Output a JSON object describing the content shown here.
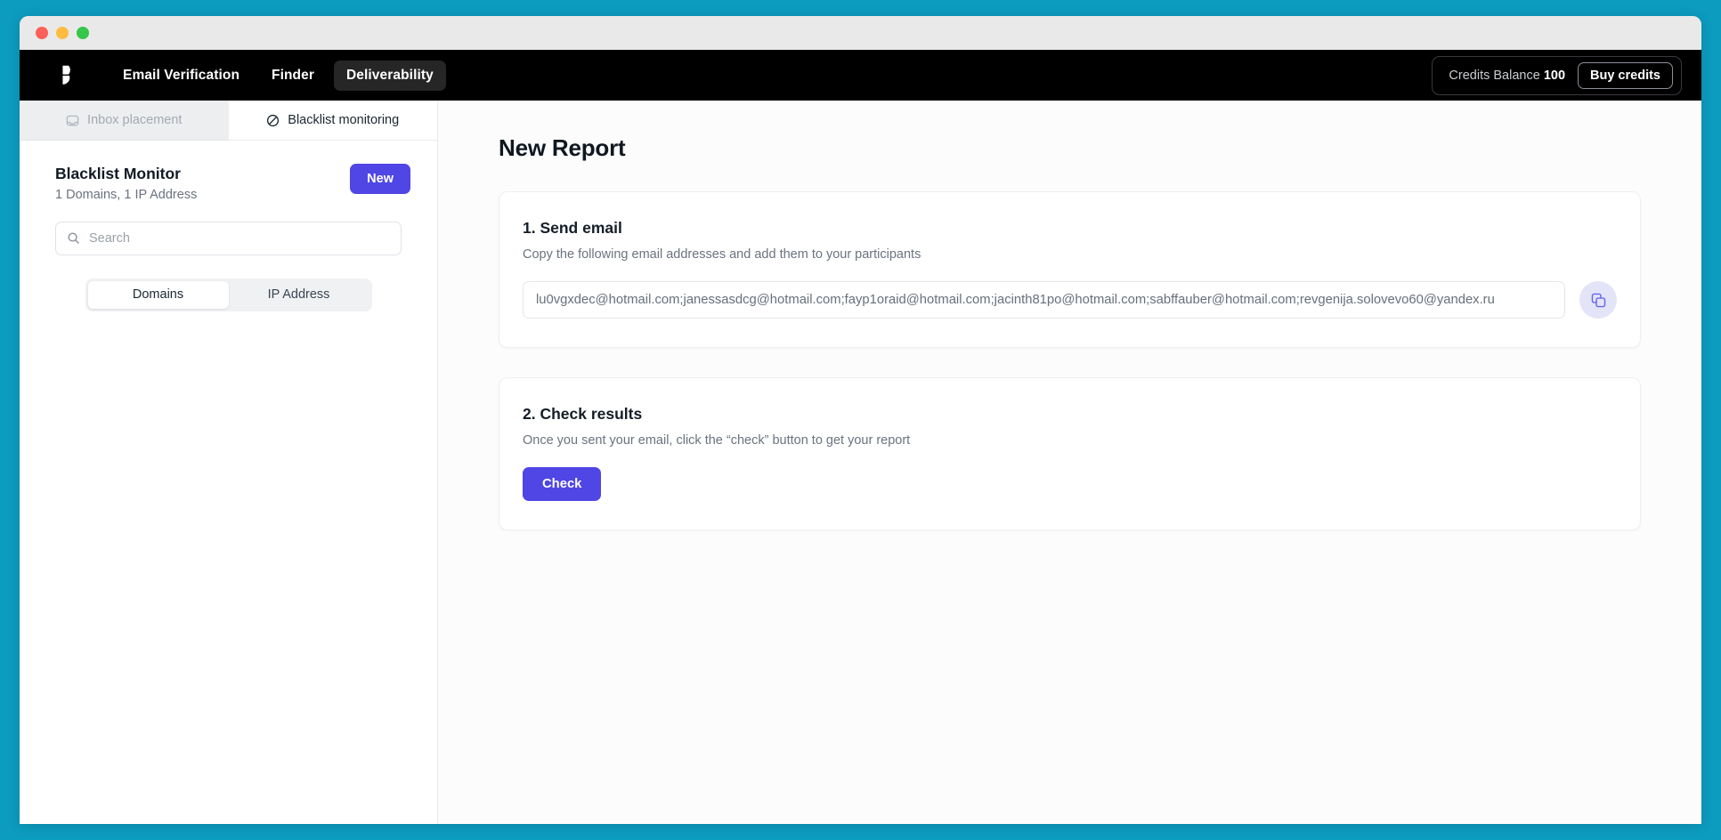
{
  "window": {
    "traffic_lights": [
      "close",
      "minimize",
      "maximize"
    ]
  },
  "topnav": {
    "logo_name": "hunter-logo",
    "links": [
      {
        "label": "Email Verification",
        "active": false
      },
      {
        "label": "Finder",
        "active": false
      },
      {
        "label": "Deliverability",
        "active": true
      }
    ],
    "credits_label": "Credits Balance",
    "credits_value": "100",
    "buy_credits_label": "Buy credits"
  },
  "sidebar": {
    "tabs": [
      {
        "label": "Inbox placement",
        "icon": "inbox-icon",
        "state": "disabled"
      },
      {
        "label": "Blacklist monitoring",
        "icon": "ban-icon",
        "state": "active"
      }
    ],
    "title": "Blacklist Monitor",
    "subtitle": "1 Domains, 1 IP Address",
    "new_button": "New",
    "search_placeholder": "Search",
    "search_value": "",
    "search_icon": "search-icon",
    "segments": [
      {
        "label": "Domains",
        "active": true
      },
      {
        "label": "IP Address",
        "active": false
      }
    ]
  },
  "main": {
    "page_title": "New Report",
    "step1": {
      "title": "1. Send email",
      "subtitle": "Copy the following email addresses and add them to your participants",
      "emails_value": "lu0vgxdec@hotmail.com;janessasdcg@hotmail.com;fayp1oraid@hotmail.com;jacinth81po@hotmail.com;sabffauber@hotmail.com;revgenija.solovevo60@yandex.ru",
      "copy_icon": "copy-icon"
    },
    "step2": {
      "title": "2. Check results",
      "subtitle": "Once you sent your email, click the “check” button to get your report",
      "check_label": "Check"
    }
  },
  "colors": {
    "desktop_background": "#0c9cc0",
    "nav_background": "#000000",
    "accent_purple": "#4f46e5",
    "copy_button_background": "#e4e4f8",
    "muted_text": "#6b7280"
  }
}
